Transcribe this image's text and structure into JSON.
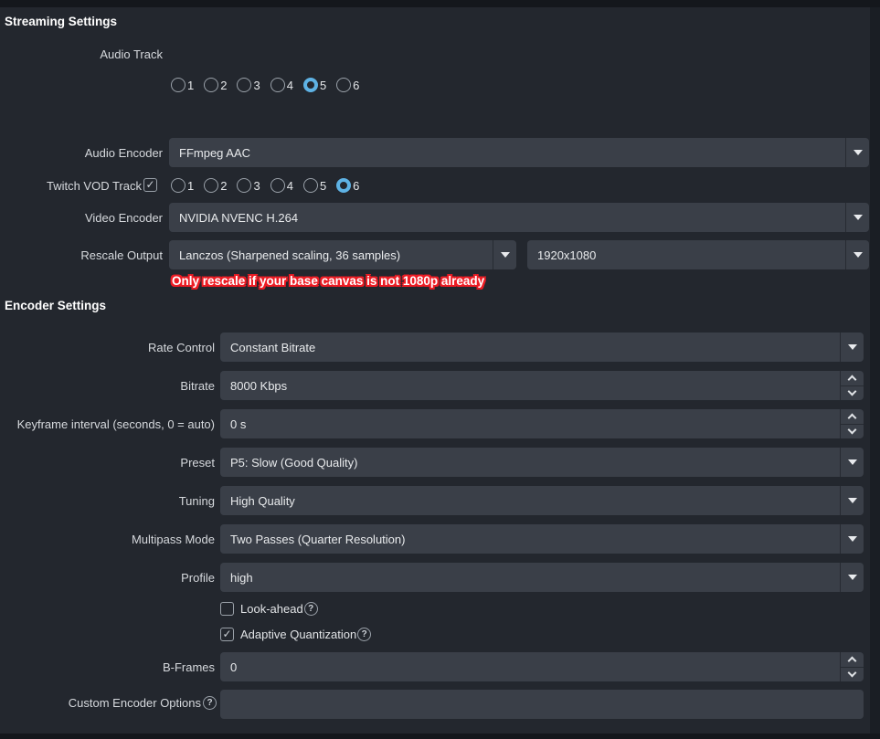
{
  "colors": {
    "page_bg": "#23272e",
    "field_bg": "#3a3f48",
    "accent_blue": "#5eb2e4",
    "annotation_red": "#ed1c24"
  },
  "icons": {
    "help": "?",
    "check": "✓",
    "dropdown_arrow": "triangle-down",
    "spin_up": "chevron-up",
    "spin_down": "chevron-down"
  },
  "streaming": {
    "title": "Streaming Settings",
    "audio_track": {
      "label": "Audio Track",
      "options": [
        "1",
        "2",
        "3",
        "4",
        "5",
        "6"
      ],
      "selected": "5"
    },
    "audio_encoder": {
      "label": "Audio Encoder",
      "value": "FFmpeg AAC"
    },
    "twitch_vod_track": {
      "label": "Twitch VOD Track",
      "checked": true,
      "options": [
        "1",
        "2",
        "3",
        "4",
        "5",
        "6"
      ],
      "selected": "6"
    },
    "video_encoder": {
      "label": "Video Encoder",
      "value": "NVIDIA NVENC H.264"
    },
    "rescale_output": {
      "label": "Rescale Output",
      "filter_value": "Lanczos (Sharpened scaling, 36 samples)",
      "resolution_value": "1920x1080"
    },
    "annotation": "Only rescale if your base canvas is not 1080p already"
  },
  "encoder": {
    "title": "Encoder Settings",
    "rate_control": {
      "label": "Rate Control",
      "value": "Constant Bitrate"
    },
    "bitrate": {
      "label": "Bitrate",
      "value": "8000 Kbps"
    },
    "keyframe_interval": {
      "label": "Keyframe interval (seconds, 0 = auto)",
      "value": "0 s"
    },
    "preset": {
      "label": "Preset",
      "value": "P5: Slow (Good Quality)"
    },
    "tuning": {
      "label": "Tuning",
      "value": "High Quality"
    },
    "multipass_mode": {
      "label": "Multipass Mode",
      "value": "Two Passes (Quarter Resolution)"
    },
    "profile": {
      "label": "Profile",
      "value": "high"
    },
    "look_ahead": {
      "label": "Look-ahead",
      "checked": false
    },
    "adaptive_quantization": {
      "label": "Adaptive Quantization",
      "checked": true
    },
    "b_frames": {
      "label": "B-Frames",
      "value": "0"
    },
    "custom_encoder_options": {
      "label": "Custom Encoder Options",
      "value": ""
    }
  }
}
